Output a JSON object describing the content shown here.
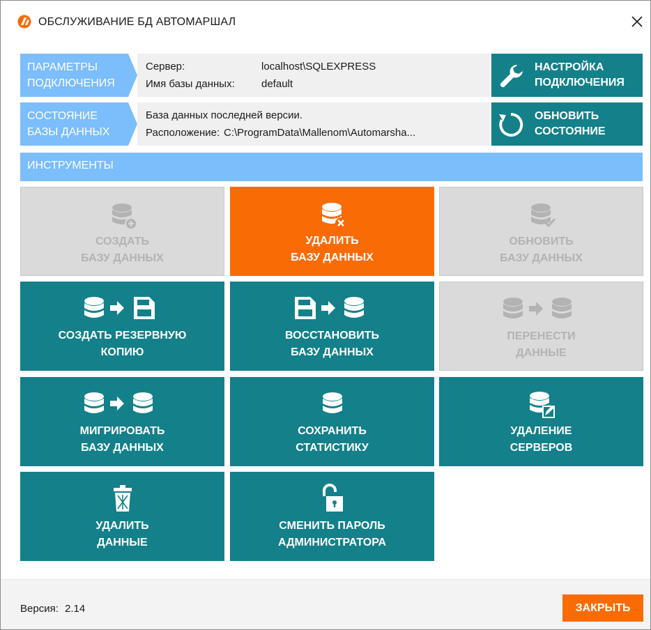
{
  "window": {
    "title": "ОБСЛУЖИВАНИЕ БД АВТОМАРШАЛ",
    "icon": "app-logo-icon",
    "close_icon": "close-icon"
  },
  "connection": {
    "tag_line1": "ПАРАМЕТРЫ",
    "tag_line2": "ПОДКЛЮЧЕНИЯ",
    "server_label": "Сервер:",
    "server_value": "localhost\\SQLEXPRESS",
    "db_label": "Имя базы данных:",
    "db_value": "default",
    "action_line1": "НАСТРОЙКА",
    "action_line2": "ПОДКЛЮЧЕНИЯ",
    "action_icon": "wrench-icon"
  },
  "db_state": {
    "tag_line1": "СОСТОЯНИЕ",
    "tag_line2": "БАЗЫ ДАННЫХ",
    "status_text": "База данных последней версии.",
    "location_label": "Расположение:",
    "location_value": "C:\\ProgramData\\Mallenom\\Automarsha...",
    "action_line1": "ОБНОВИТЬ",
    "action_line2": "СОСТОЯНИЕ",
    "action_icon": "refresh-icon"
  },
  "tools": {
    "header": "ИНСТРУМЕНТЫ",
    "tiles": [
      {
        "line1": "СОЗДАТЬ",
        "line2": "БАЗУ ДАННЫХ",
        "state": "disabled",
        "icon": "database-add-icon"
      },
      {
        "line1": "УДАЛИТЬ",
        "line2": "БАЗУ ДАННЫХ",
        "state": "danger",
        "icon": "database-delete-icon"
      },
      {
        "line1": "ОБНОВИТЬ",
        "line2": "БАЗУ ДАННЫХ",
        "state": "disabled",
        "icon": "database-check-icon"
      },
      {
        "line1": "СОЗДАТЬ РЕЗЕРВНУЮ",
        "line2": "КОПИЮ",
        "state": "enabled",
        "icon": "database-to-floppy-icon"
      },
      {
        "line1": "ВОССТАНОВИТЬ",
        "line2": "БАЗУ ДАННЫХ",
        "state": "enabled",
        "icon": "floppy-to-database-icon"
      },
      {
        "line1": "ПЕРЕНЕСТИ",
        "line2": "ДАННЫЕ",
        "state": "disabled",
        "icon": "database-transfer-icon"
      },
      {
        "line1": "МИГРИРОВАТЬ",
        "line2": "БАЗУ ДАННЫХ",
        "state": "enabled",
        "icon": "database-migrate-icon"
      },
      {
        "line1": "СОХРАНИТЬ",
        "line2": "СТАТИСТИКУ",
        "state": "enabled",
        "icon": "database-icon"
      },
      {
        "line1": "УДАЛЕНИЕ",
        "line2": "СЕРВЕРОВ",
        "state": "enabled",
        "icon": "database-edit-icon"
      },
      {
        "line1": "УДАЛИТЬ",
        "line2": "ДАННЫЕ",
        "state": "enabled",
        "icon": "trash-bin-icon"
      },
      {
        "line1": "СМЕНИТЬ ПАРОЛЬ",
        "line2": "АДМИНИСТРАТОРА",
        "state": "enabled",
        "icon": "unlock-icon"
      }
    ]
  },
  "footer": {
    "version_label": "Версия:",
    "version_value": "2.14",
    "close_label": "ЗАКРЫТЬ"
  },
  "colors": {
    "teal": "#13808a",
    "orange": "#f96b05",
    "light_blue": "#7cbdfc",
    "disabled_gray": "#dadada"
  }
}
